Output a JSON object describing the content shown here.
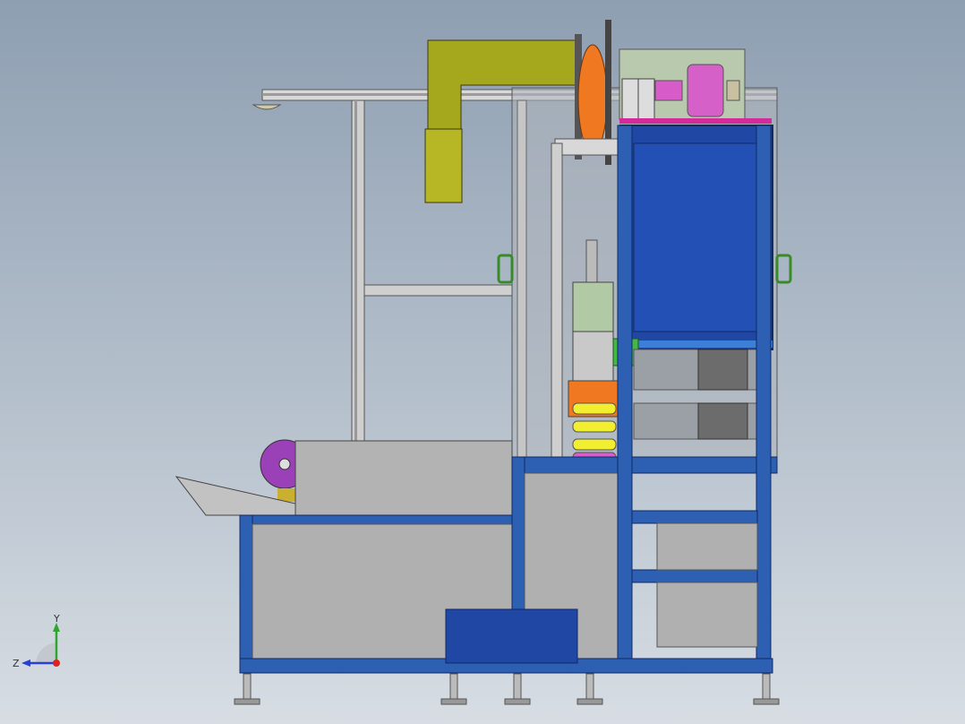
{
  "viewport": {
    "background_top": "#8e9fb2",
    "background_bottom": "#d7dde3"
  },
  "model": {
    "frame_color": "#2d5fb3",
    "panel_color": "#1f47a3",
    "sheet_metal_color": "#b3b3b3",
    "duct_color": "#a5a81c",
    "spool_color": "#f07820",
    "roller_color": "#f2ee30",
    "motor_color": "#d460c8"
  },
  "triad": {
    "y_label": "Y",
    "z_label": "Z",
    "y_color": "#2fa52f",
    "z_color": "#2a3fd6",
    "origin_color": "#d22"
  }
}
